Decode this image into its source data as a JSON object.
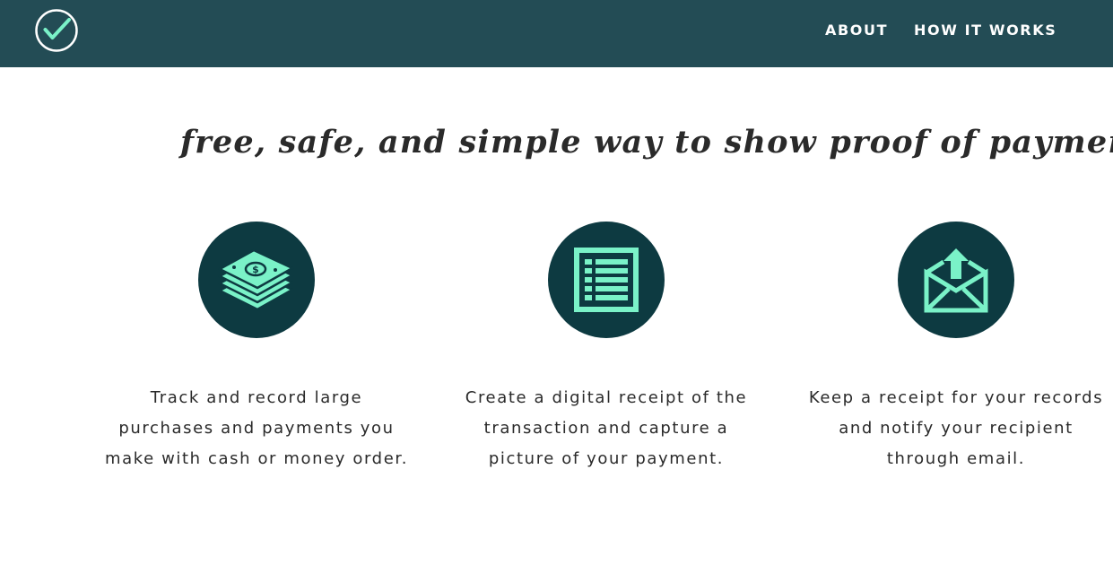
{
  "nav": {
    "logo_icon": "check-circle-icon",
    "links": [
      {
        "label": "ABOUT"
      },
      {
        "label": "HOW IT WORKS"
      }
    ]
  },
  "hero": {
    "tagline": "free, safe, and simple way to show proof of payment"
  },
  "features": [
    {
      "icon": "money-stack-icon",
      "lines": [
        "Track and record large",
        "purchases and payments you",
        "make with cash or money order."
      ]
    },
    {
      "icon": "receipt-list-icon",
      "lines": [
        "Create a digital receipt of the",
        "transaction and capture a",
        "picture of your payment."
      ]
    },
    {
      "icon": "envelope-upload-icon",
      "lines": [
        "Keep a receipt for your records",
        "and notify your recipient",
        "through email."
      ]
    }
  ],
  "colors": {
    "nav_bg": "#234c55",
    "icon_bg": "#0d3a41",
    "accent": "#7af2c8",
    "text": "#2a2a2a"
  }
}
